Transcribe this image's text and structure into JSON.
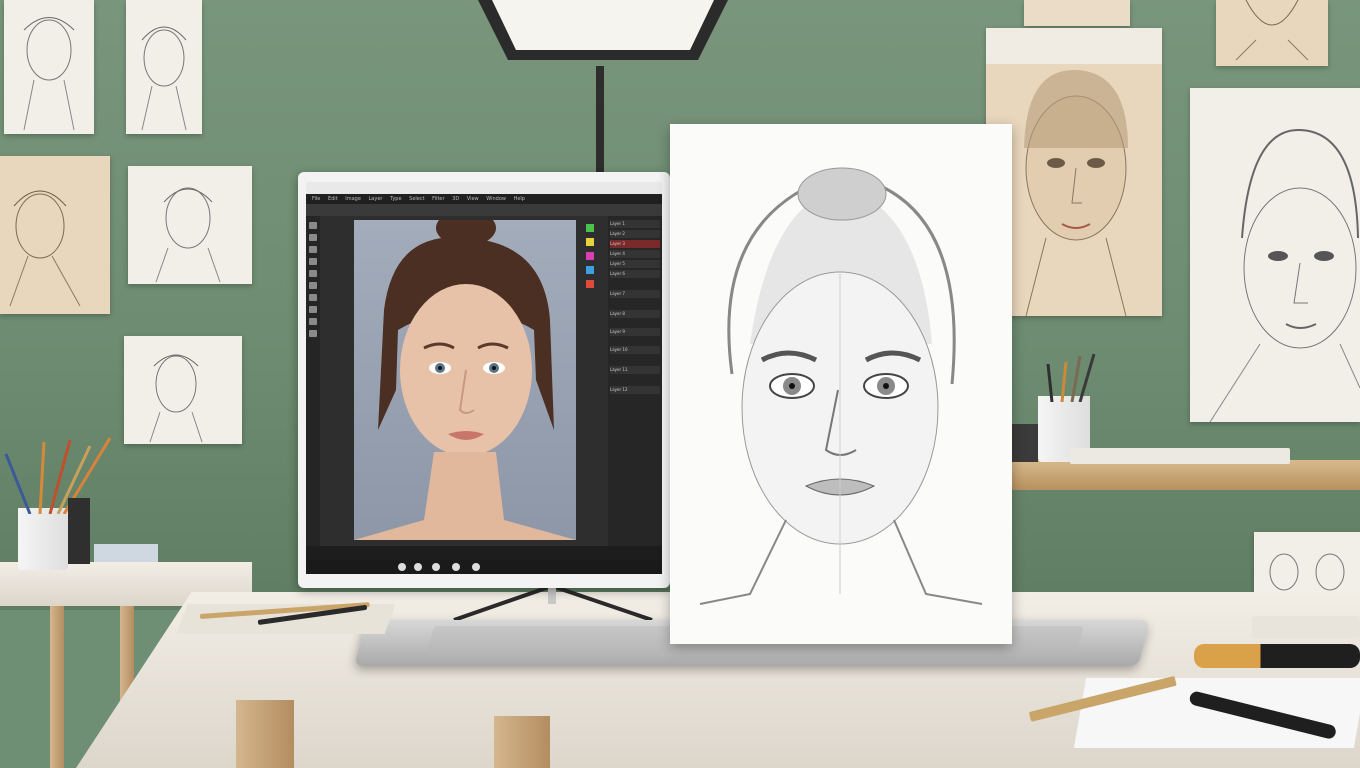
{
  "scene": {
    "description_items": [
      "wall",
      "drawings",
      "desk",
      "monitor",
      "sketch",
      "laptop"
    ],
    "colors": {
      "wall_green": "#6f8f74",
      "desk_white": "#f2eee6",
      "monitor_bezel": "#f3f3f3",
      "app_dark": "#2e2e2e",
      "canvas_bg": "#9aa3b2",
      "sketch_paper": "#fbfbf9"
    }
  },
  "editor": {
    "menu_items": [
      "File",
      "Edit",
      "Image",
      "Layer",
      "Type",
      "Select",
      "Filter",
      "3D",
      "View",
      "Window",
      "Help"
    ],
    "layers": [
      "Layer 1",
      "Layer 2",
      "Layer 3",
      "Layer 4",
      "Layer 5",
      "Layer 6",
      "Layer 7",
      "Layer 8",
      "Layer 9",
      "Layer 10",
      "Layer 11",
      "Layer 12"
    ]
  },
  "icons": [
    "lamp-icon",
    "pencil-icon",
    "brush-icon",
    "tool-icon"
  ]
}
